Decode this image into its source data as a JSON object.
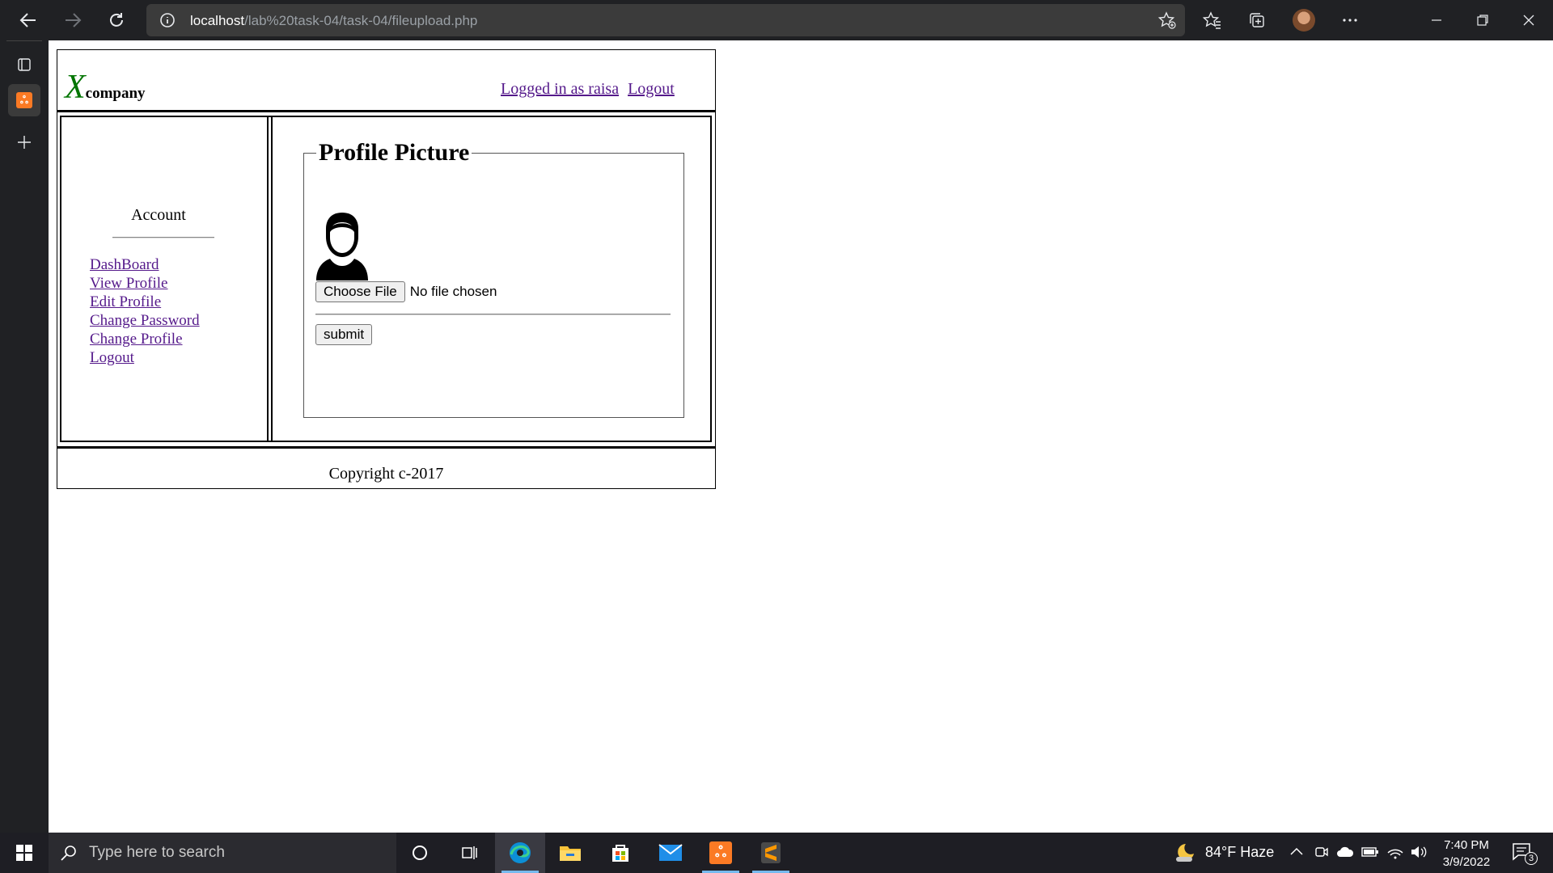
{
  "browser": {
    "url_host": "localhost",
    "url_path": "/lab%20task-04/task-04/fileupload.php"
  },
  "header": {
    "logo_letter": "X",
    "logo_word": "company",
    "logged_in_text": "Logged in as raisa",
    "logout_label": "Logout"
  },
  "sidebar": {
    "title": "Account",
    "items": [
      {
        "label": "DashBoard"
      },
      {
        "label": "View Profile"
      },
      {
        "label": "Edit Profile"
      },
      {
        "label": "Change Password"
      },
      {
        "label": "Change Profile"
      },
      {
        "label": "Logout"
      }
    ]
  },
  "main": {
    "legend": "Profile Picture",
    "choose_file_label": "Choose File",
    "file_status": "No file chosen",
    "submit_label": "submit"
  },
  "footer": {
    "copyright": "Copyright c-2017"
  },
  "taskbar": {
    "search_placeholder": "Type here to search",
    "weather": "84°F  Haze",
    "time": "7:40 PM",
    "date": "3/9/2022",
    "notification_count": "3"
  },
  "colors": {
    "logo_accent": "#007500",
    "visited_link": "#551a8b",
    "chrome_bg": "#202124",
    "taskbar_bg": "#1e1e24"
  },
  "icons": [
    "back-icon",
    "forward-icon",
    "refresh-icon",
    "info-icon",
    "add-favorite-icon",
    "favorites-icon",
    "collections-icon",
    "more-icon",
    "minimize-icon",
    "restore-icon",
    "close-icon",
    "tab-actions-icon",
    "xampp-icon",
    "new-tab-icon",
    "user-silhouette-icon",
    "windows-icon",
    "search-icon",
    "cortana-icon",
    "task-view-icon",
    "edge-icon",
    "file-explorer-icon",
    "store-icon",
    "mail-icon",
    "sublime-icon",
    "weather-moon-icon",
    "chevron-up-icon",
    "meet-now-icon",
    "onedrive-icon",
    "battery-icon",
    "wifi-icon",
    "volume-icon",
    "notification-icon"
  ]
}
